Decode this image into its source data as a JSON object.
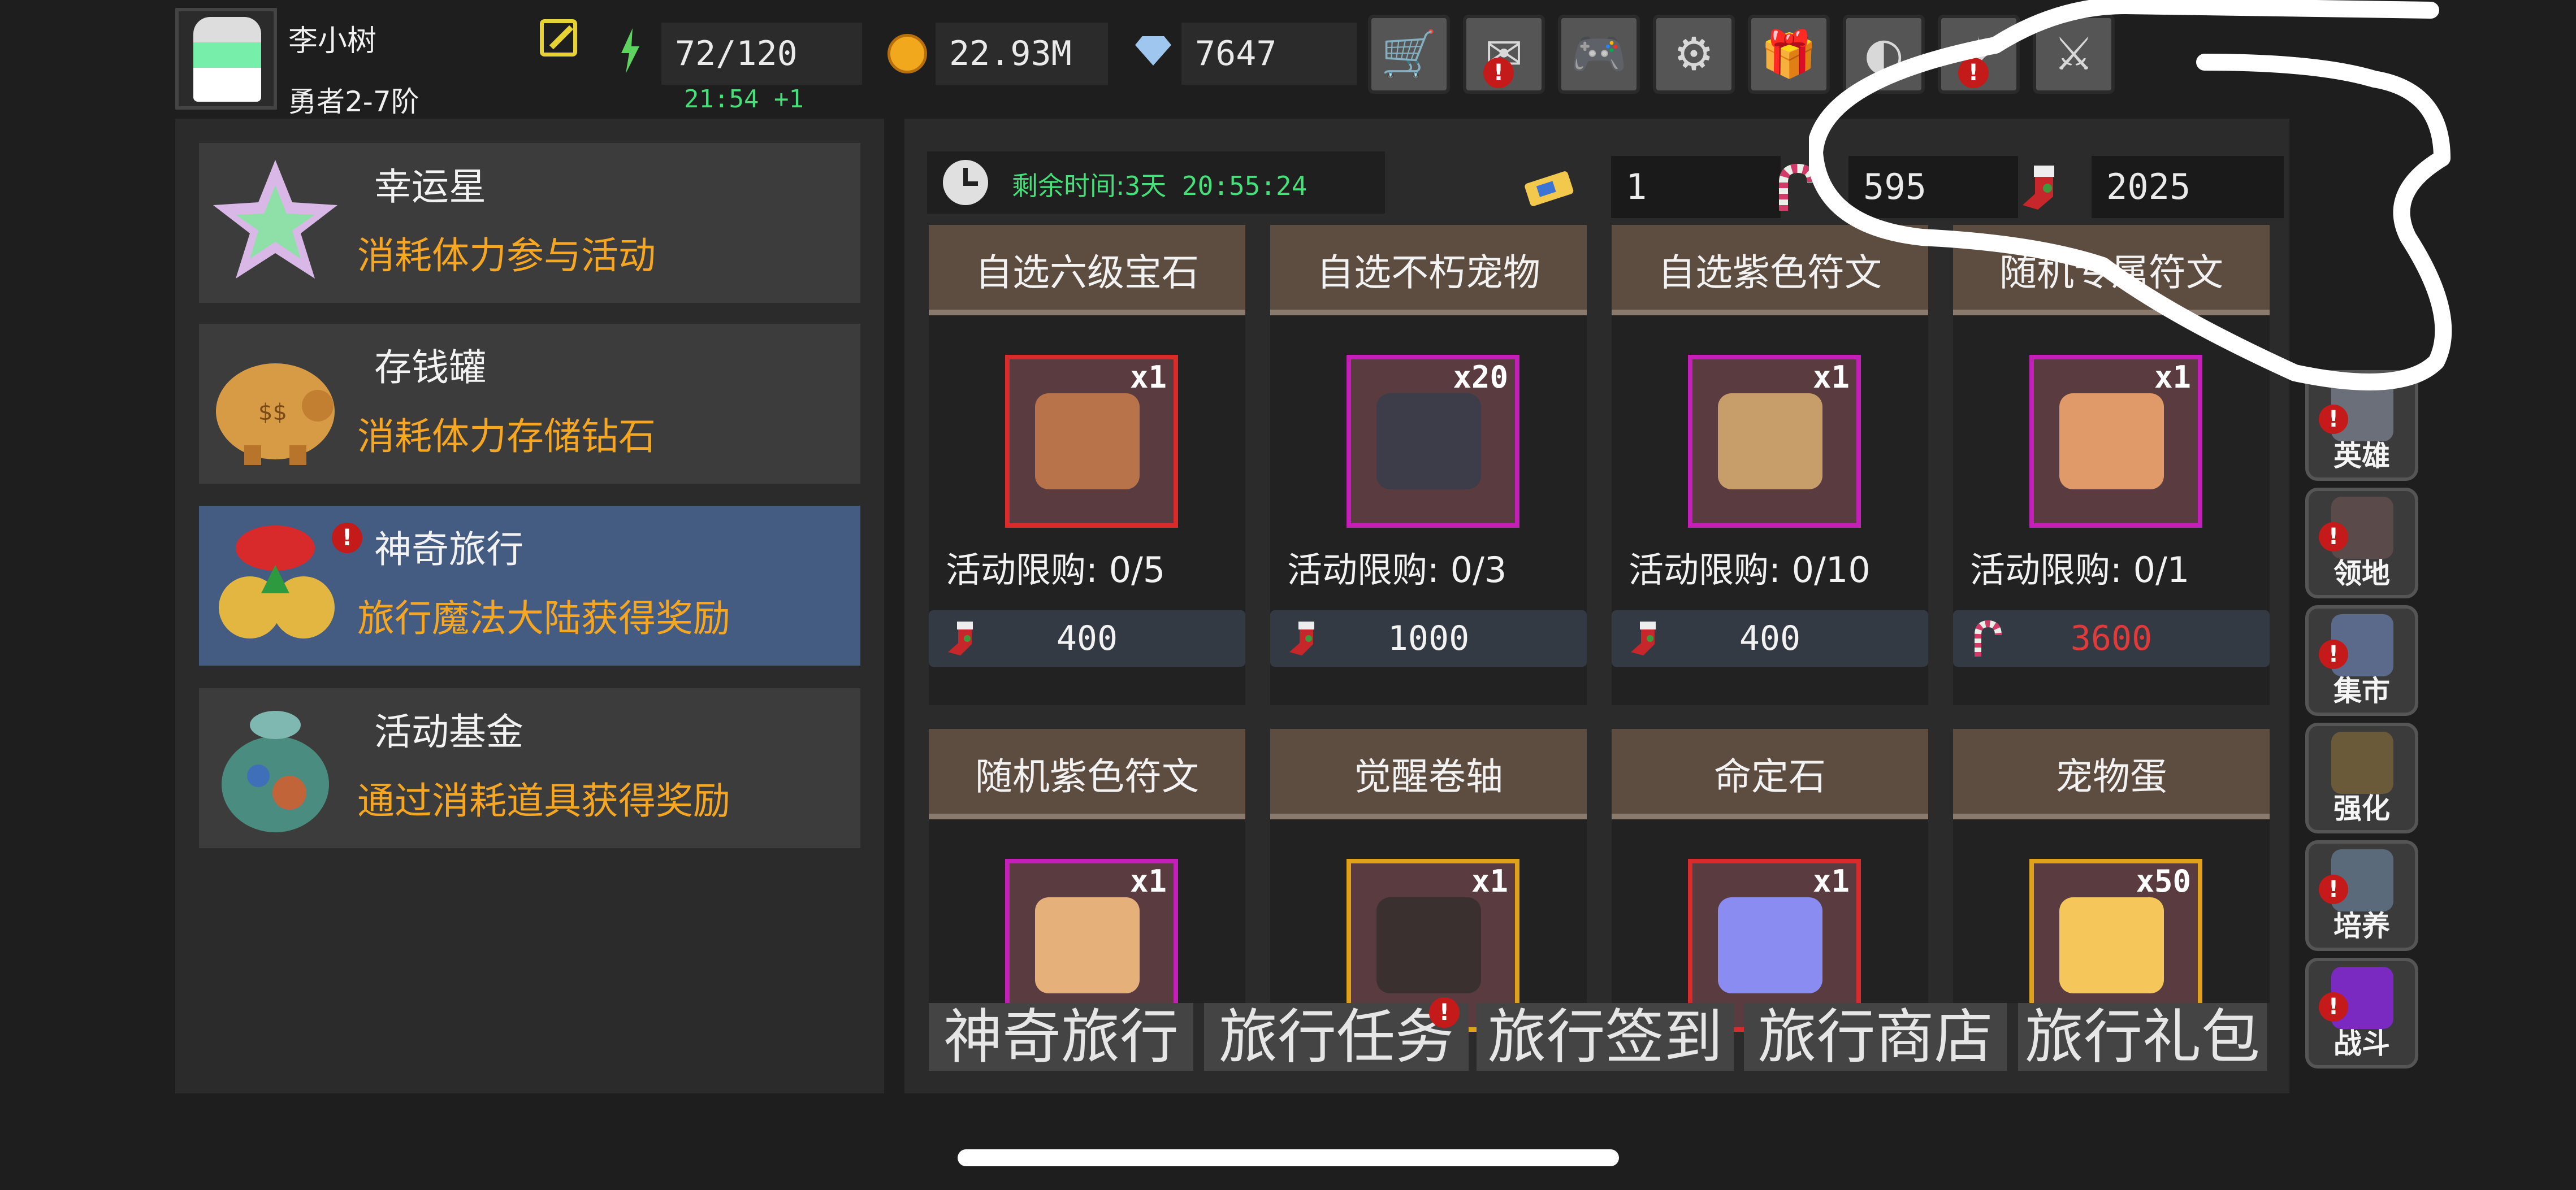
{
  "player": {
    "name": "李小树",
    "rank": "勇者2-7阶"
  },
  "stats": {
    "energy": "72/120",
    "energy_regen": "21:54 +1",
    "gold": "22.93M",
    "gems": "7647"
  },
  "top_buttons": [
    {
      "icon": "cart-icon",
      "glyph": "🛒",
      "alert": false
    },
    {
      "icon": "mail-icon",
      "glyph": "✉",
      "alert": true
    },
    {
      "icon": "gamepad-icon",
      "glyph": "🎮",
      "alert": false
    },
    {
      "icon": "gear-icon",
      "glyph": "⚙",
      "alert": false
    },
    {
      "icon": "gift-icon",
      "glyph": "🎁",
      "alert": false
    },
    {
      "icon": "bag-icon",
      "glyph": "◐",
      "alert": false
    },
    {
      "icon": "event-icon",
      "glyph": "✦",
      "alert": true
    },
    {
      "icon": "swords-icon",
      "glyph": "⚔",
      "alert": false
    }
  ],
  "menu": [
    {
      "title": "幸运星",
      "desc": "消耗体力参与活动",
      "active": false,
      "alert": false
    },
    {
      "title": "存钱罐",
      "desc": "消耗体力存储钻石",
      "active": false,
      "alert": false
    },
    {
      "title": "神奇旅行",
      "desc": "旅行魔法大陆获得奖励",
      "active": true,
      "alert": true
    },
    {
      "title": "活动基金",
      "desc": "通过消耗道具获得奖励",
      "active": false,
      "alert": false
    }
  ],
  "event": {
    "timer_label": "剩余时间:",
    "timer_value": "3天 20:55:24",
    "currencies": [
      "1",
      "595",
      "2025"
    ]
  },
  "shop_items": [
    {
      "name": "自选六级宝石",
      "qty": "x1",
      "limit": "活动限购: 0/5",
      "price": "400",
      "price_red": false,
      "frame": "#d92b2b",
      "art": "#b8734a"
    },
    {
      "name": "自选不朽宠物",
      "qty": "x20",
      "limit": "活动限购: 0/3",
      "price": "1000",
      "price_red": false,
      "frame": "#c41fb8",
      "art": "#3d3d4a"
    },
    {
      "name": "自选紫色符文",
      "qty": "x1",
      "limit": "活动限购: 0/10",
      "price": "400",
      "price_red": false,
      "frame": "#c41fb8",
      "art": "#c79d6a"
    },
    {
      "name": "随机专属符文",
      "qty": "x1",
      "limit": "活动限购: 0/1",
      "price": "3600",
      "price_red": true,
      "frame": "#c41fb8",
      "art": "#e09a6a"
    },
    {
      "name": "随机紫色符文",
      "qty": "x1",
      "limit": "",
      "price": "",
      "price_red": false,
      "frame": "#c41fb8",
      "art": "#e6b07a"
    },
    {
      "name": "觉醒卷轴",
      "qty": "x1",
      "limit": "",
      "price": "",
      "price_red": false,
      "frame": "#e0a21a",
      "art": "#3a3030"
    },
    {
      "name": "命定石",
      "qty": "x1",
      "limit": "",
      "price": "",
      "price_red": false,
      "frame": "#d92b2b",
      "art": "#8a8cf2"
    },
    {
      "name": "宠物蛋",
      "qty": "x50",
      "limit": "",
      "price": "",
      "price_red": false,
      "frame": "#e0a21a",
      "art": "#f5c65a"
    }
  ],
  "tabs": [
    "神奇旅行",
    "旅行任务",
    "旅行签到",
    "旅行商店",
    "旅行礼包"
  ],
  "side_nav": [
    {
      "label": "英雄",
      "alert": true,
      "art": "#6b6f7a"
    },
    {
      "label": "领地",
      "alert": true,
      "art": "#5a4a4a"
    },
    {
      "label": "集市",
      "alert": true,
      "art": "#5b6a8a"
    },
    {
      "label": "强化",
      "alert": false,
      "art": "#6a5a3a"
    },
    {
      "label": "培养",
      "alert": true,
      "art": "#5a6a7a"
    },
    {
      "label": "战斗",
      "alert": true,
      "art": "#7a2ac0"
    }
  ],
  "colors": {
    "accent_orange": "#f5a623",
    "timer_green": "#45e07a",
    "active_blue": "#455c82"
  }
}
